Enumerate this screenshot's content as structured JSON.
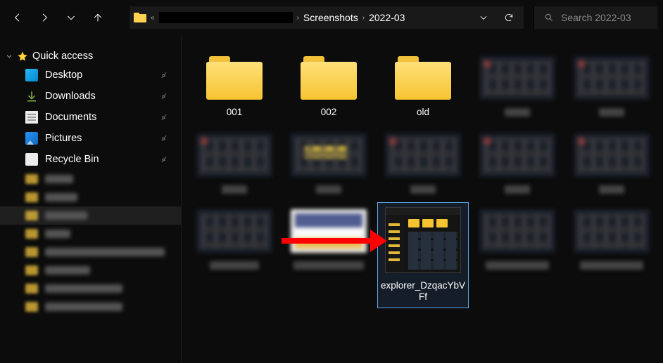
{
  "breadcrumb": {
    "seg1": "Screenshots",
    "seg2": "2022-03"
  },
  "search": {
    "placeholder": "Search 2022-03"
  },
  "sidebar": {
    "quick": "Quick access",
    "items": [
      "Desktop",
      "Downloads",
      "Documents",
      "Pictures",
      "Recycle Bin"
    ]
  },
  "folders": [
    "001",
    "002",
    "old"
  ],
  "selected_file": "explorer_DzqacYbVFf",
  "blur_widths": {
    "side": [
      40,
      46,
      60,
      36,
      170,
      64,
      110,
      110
    ],
    "row2": [
      36,
      36,
      36,
      36,
      36
    ],
    "row3": [
      70,
      100,
      90
    ]
  }
}
